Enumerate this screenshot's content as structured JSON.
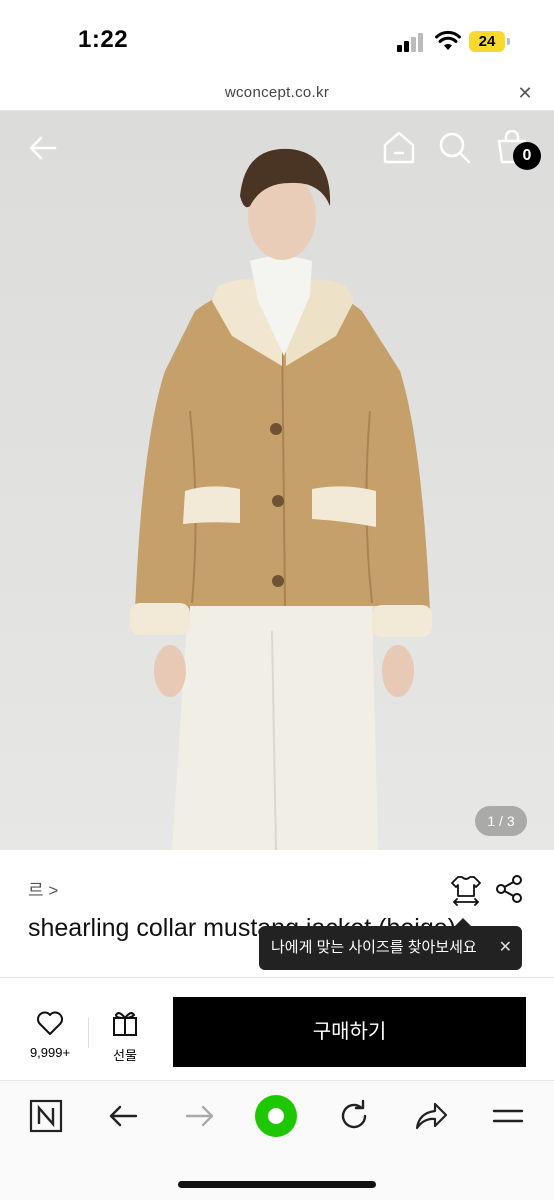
{
  "status_bar": {
    "time": "1:22",
    "battery": "24"
  },
  "url_bar": {
    "domain": "wconcept.co.kr"
  },
  "hero": {
    "cart_count": "0",
    "pager": "1 / 3"
  },
  "product": {
    "brand_crumb": "르 >",
    "title": "shearling collar mustang jacket (beige)",
    "size_tooltip": "나에게 맞는 사이즈를 찾아보세요"
  },
  "buy_bar": {
    "wish_count": "9,999+",
    "gift_label": "선물",
    "buy_label": "구매하기"
  },
  "colors": {
    "accent": "#000000",
    "nav_green": "#1ec800",
    "battery": "#f8d92c"
  },
  "icons": [
    "back-arrow-icon",
    "home-icon",
    "search-icon",
    "cart-icon",
    "size-guide-icon",
    "share-icon",
    "heart-icon",
    "gift-icon",
    "naver-n-icon",
    "forward-arrow-icon",
    "reload-icon",
    "browser-share-icon",
    "menu-icon"
  ]
}
